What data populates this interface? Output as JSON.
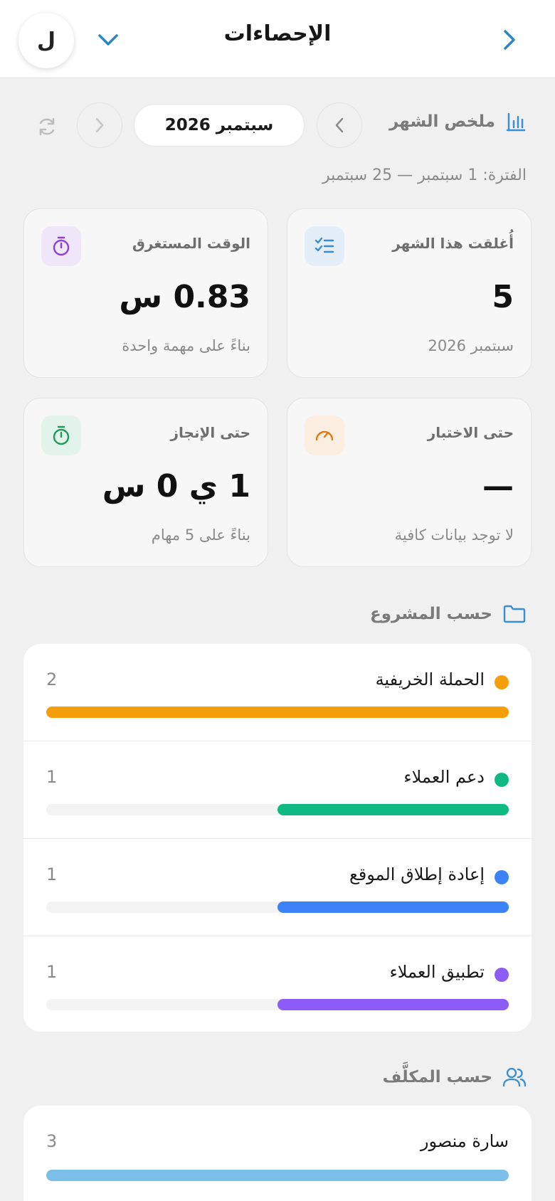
{
  "header": {
    "title": "الإحصاءات",
    "avatar_letter": "ل",
    "back_icon": "chevron-right-icon",
    "dropdown_icon": "chevron-down-icon"
  },
  "summary": {
    "label": "ملخص الشهر",
    "icon": "bar-chart-icon",
    "month": "سبتمبر 2026",
    "period": "الفترة: 1 سبتمبر — 25 سبتمبر"
  },
  "cards": [
    {
      "label": "أُغلقت هذا الشهر",
      "value": "5",
      "sub": "سبتمبر 2026",
      "icon": "checklist-icon",
      "icon_color": "#3b8fd0",
      "icon_bg": "#e4eef8"
    },
    {
      "label": "الوقت المستغرق",
      "value": "0.83 س",
      "sub": "بناءً على مهمة واحدة",
      "icon": "timer-icon",
      "icon_color": "#8b3fd6",
      "icon_bg": "#efe6fa"
    },
    {
      "label": "حتى الاختبار",
      "value": "—",
      "sub": "لا توجد بيانات كافية",
      "icon": "gauge-icon",
      "icon_color": "#e07a12",
      "icon_bg": "#fbeee0"
    },
    {
      "label": "حتى الإنجاز",
      "value": "1 ي 0 س",
      "sub": "بناءً على 5 مهام",
      "icon": "timer-icon",
      "icon_color": "#1e9a5a",
      "icon_bg": "#e2f3ea"
    }
  ],
  "by_project": {
    "title": "حسب المشروع",
    "icon": "folder-icon",
    "items": [
      {
        "name": "الحملة الخريفية",
        "count": "2",
        "fraction": 1.0,
        "color": "#f59e0b"
      },
      {
        "name": "دعم العملاء",
        "count": "1",
        "fraction": 0.5,
        "color": "#10b981"
      },
      {
        "name": "إعادة إطلاق الموقع",
        "count": "1",
        "fraction": 0.5,
        "color": "#3b82f6"
      },
      {
        "name": "تطبيق العملاء",
        "count": "1",
        "fraction": 0.5,
        "color": "#8b5cf6"
      }
    ]
  },
  "by_assignee": {
    "title": "حسب المكلَّف",
    "icon": "users-icon",
    "items": [
      {
        "name": "سارة منصور",
        "count": "3",
        "fraction": 1.0,
        "color": "#7bbfe8"
      }
    ]
  }
}
